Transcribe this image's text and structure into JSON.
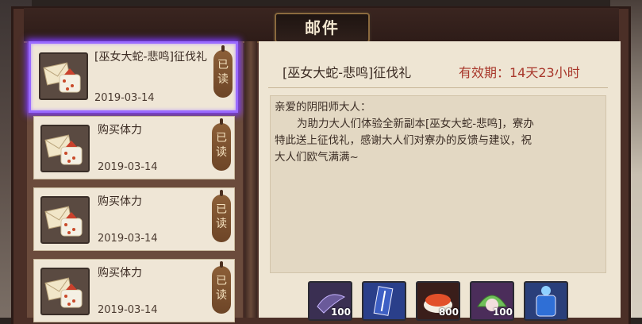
{
  "window": {
    "title": "邮件"
  },
  "mail_list": [
    {
      "title": "[巫女大蛇-悲鸣]征伐礼",
      "date": "2019-03-14",
      "status": [
        "已",
        "读"
      ],
      "selected": true
    },
    {
      "title": "购买体力",
      "date": "2019-03-14",
      "status": [
        "已",
        "读"
      ],
      "selected": false
    },
    {
      "title": "购买体力",
      "date": "2019-03-14",
      "status": [
        "已",
        "读"
      ],
      "selected": false
    },
    {
      "title": "购买体力",
      "date": "2019-03-14",
      "status": [
        "已",
        "读"
      ],
      "selected": false
    }
  ],
  "detail": {
    "title": "[巫女大蛇-悲鸣]征伐礼",
    "validity": "有效期：14天23小时",
    "greeting": "亲爱的阴阳师大人：",
    "body_line1": "为助力大人们体验全新副本[巫女大蛇-悲鸣]，寮办",
    "body_line2": "特此送上征伐礼，感谢大人们对寮办的反馈与建议，祝",
    "body_line3": "大人们欧气满满~"
  },
  "rewards": [
    {
      "icon": "dark-scroll-icon",
      "count": "100",
      "color": "#3a2f52"
    },
    {
      "icon": "blue-talisman-icon",
      "count": "",
      "color": "#2a3f8a"
    },
    {
      "icon": "sushi-icon",
      "count": "800",
      "color": "#3a1e1a"
    },
    {
      "icon": "rice-cake-icon",
      "count": "100",
      "color": "#4b2d5a"
    },
    {
      "icon": "blue-charm-icon",
      "count": "",
      "color": "#2a3f7a"
    }
  ]
}
